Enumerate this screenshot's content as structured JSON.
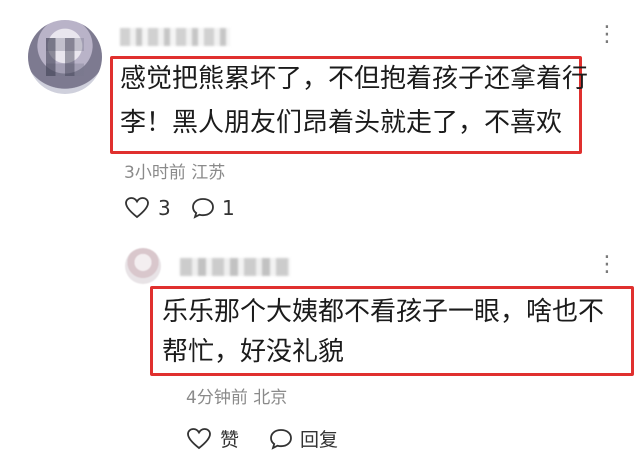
{
  "comment": {
    "more_glyph": "⋮",
    "text_line1": "感觉把熊累坏了，不但抱着孩子还拿着行",
    "text_line2": "李！黑人朋友们昂着头就走了，不喜欢",
    "meta": "3小时前 江苏",
    "like_count": "3",
    "reply_count": "1"
  },
  "reply": {
    "more_glyph": "⋮",
    "text_line1": "乐乐那个大姨都不看孩子一眼，啥也不",
    "text_line2": "帮忙，好没礼貌",
    "meta": "4分钟前 北京",
    "like_label": "赞",
    "reply_label": "回复"
  },
  "colors": {
    "highlight_border": "#e0302e",
    "meta_text": "#8a8a8a"
  },
  "icons": [
    "more-vertical-icon",
    "heart-icon",
    "comment-bubble-icon"
  ]
}
